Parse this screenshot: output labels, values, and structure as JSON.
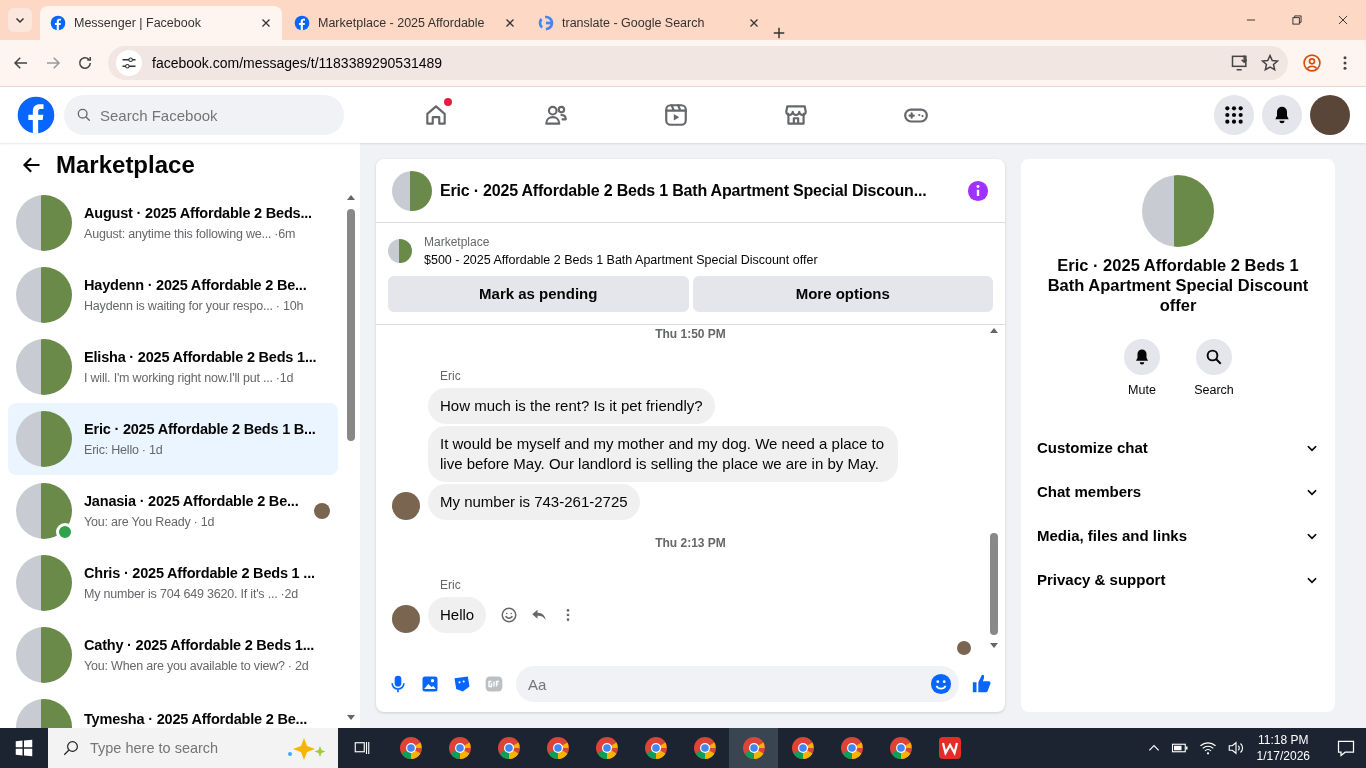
{
  "browser": {
    "tabs": [
      {
        "title": "Messenger | Facebook",
        "kind": "facebook",
        "selected": true
      },
      {
        "title": "Marketplace - 2025 Affordable",
        "kind": "facebook",
        "selected": false
      },
      {
        "title": "translate - Google Search",
        "kind": "google",
        "selected": false
      }
    ],
    "url": "facebook.com/messages/t/1183389290531489"
  },
  "topnav": {
    "search_placeholder": "Search Facebook",
    "nav_icons": [
      {
        "kind": "home",
        "badge": true
      },
      {
        "kind": "friends",
        "badge": false
      },
      {
        "kind": "video",
        "badge": false
      },
      {
        "kind": "store",
        "badge": false
      },
      {
        "kind": "gaming",
        "badge": false
      }
    ]
  },
  "sidebar": {
    "title": "Marketplace",
    "conversations": [
      {
        "title": "August · 2025 Affordable 2 Beds...",
        "preview": "August: anytime this following we...",
        "time": "·6m",
        "selected": false,
        "online": false,
        "seen": false
      },
      {
        "title": "Haydenn · 2025 Affordable 2 Be...",
        "preview": "Haydenn is waiting for your respo...",
        "time": "· 10h",
        "selected": false,
        "online": false,
        "seen": false
      },
      {
        "title": "Elisha · 2025 Affordable 2 Beds 1...",
        "preview": "I will. I'm working right now.I'll put ...",
        "time": "·1d",
        "selected": false,
        "online": false,
        "seen": false
      },
      {
        "title": "Eric · 2025 Affordable 2 Beds 1 B...",
        "preview": "Eric: Hello",
        "time": "· 1d",
        "selected": true,
        "online": false,
        "seen": false
      },
      {
        "title": "Janasia · 2025 Affordable 2 Be...",
        "preview": "You: are You Ready",
        "time": "· 1d",
        "selected": false,
        "online": true,
        "seen": true
      },
      {
        "title": "Chris · 2025 Affordable 2 Beds 1 ...",
        "preview": "My number is 704 649 3620. If it's ...",
        "time": "·2d",
        "selected": false,
        "online": false,
        "seen": false
      },
      {
        "title": "Cathy · 2025 Affordable 2 Beds 1...",
        "preview": "You: When are you available to view?",
        "time": "· 2d",
        "selected": false,
        "online": false,
        "seen": false
      },
      {
        "title": "Tymesha · 2025 Affordable 2 Be...",
        "selected": false,
        "online": false,
        "seen": false
      }
    ]
  },
  "chat": {
    "title": "Eric · 2025 Affordable 2 Beds 1 Bath Apartment Special Discoun...",
    "listing": {
      "label": "Marketplace",
      "text": "$500 - 2025 Affordable 2 Beds 1 Bath Apartment Special Discount offer"
    },
    "buttons": [
      "Mark as pending",
      "More options"
    ],
    "messages": [
      {
        "kind": "timestamp",
        "text": "Thu 1:50 PM"
      },
      {
        "kind": "sender",
        "text": "Eric"
      },
      {
        "kind": "bubble",
        "text": "How much is the rent? Is it pet friendly?",
        "avatar": false,
        "actions": false
      },
      {
        "kind": "bubble",
        "text": "It would be myself and my mother and my dog.  We need a place to live before May. Our landlord is selling the place we are in by May.",
        "avatar": false,
        "actions": false
      },
      {
        "kind": "bubble",
        "text": "My number is 743-261-2725",
        "avatar": true,
        "actions": false
      },
      {
        "kind": "timestamp",
        "text": "Thu 2:13 PM"
      },
      {
        "kind": "sender",
        "text": "Eric"
      },
      {
        "kind": "bubble",
        "text": "Hello",
        "avatar": true,
        "actions": true
      }
    ],
    "seen_receipt": true,
    "composer_placeholder": "Aa"
  },
  "info": {
    "title": "Eric · 2025 Affordable 2 Beds 1 Bath Apartment Special Discount offer",
    "actions": [
      {
        "kind": "bell",
        "label": "Mute"
      },
      {
        "kind": "search",
        "label": "Search"
      }
    ],
    "sections": [
      "Customize chat",
      "Chat members",
      "Media, files and links",
      "Privacy & support"
    ]
  },
  "taskbar": {
    "search_placeholder": "Type here to search",
    "apps": [
      {
        "kind": "chrome",
        "active": false
      },
      {
        "kind": "chrome",
        "active": false
      },
      {
        "kind": "chrome",
        "active": false
      },
      {
        "kind": "chrome",
        "active": false
      },
      {
        "kind": "chrome",
        "active": false
      },
      {
        "kind": "chrome",
        "active": false
      },
      {
        "kind": "chrome",
        "active": false
      },
      {
        "kind": "chrome",
        "active": true
      },
      {
        "kind": "chrome",
        "active": false
      },
      {
        "kind": "chrome",
        "active": false
      },
      {
        "kind": "chrome",
        "active": false
      },
      {
        "kind": "wps",
        "active": false
      }
    ],
    "time": "11:18 PM",
    "date": "1/17/2026"
  }
}
